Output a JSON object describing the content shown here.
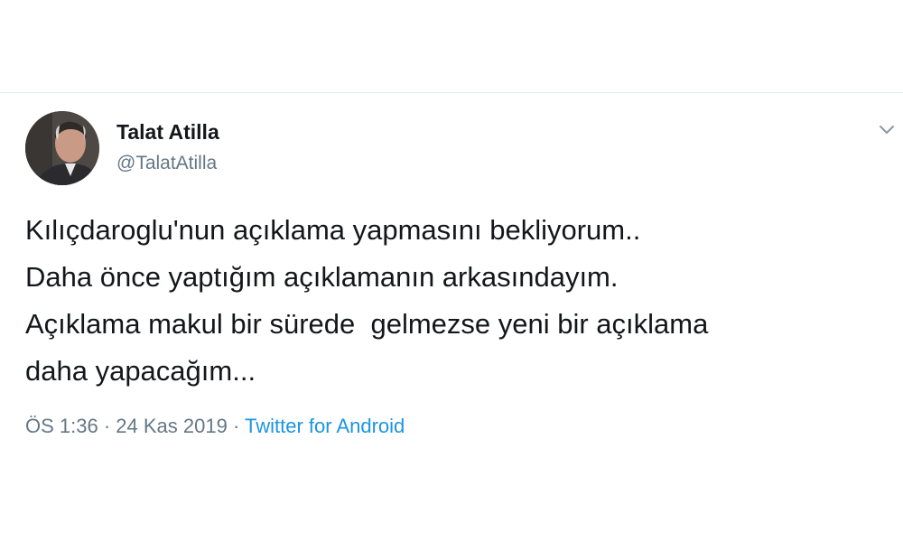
{
  "tweet": {
    "author": {
      "display_name": "Talat Atilla",
      "handle": "@TalatAtilla"
    },
    "text_lines": [
      "Kılıçdaroglu'nun açıklama yapmasını bekliyorum..",
      "Daha önce yaptığım açıklamanın arkasındayım.",
      "Açıklama makul bir sürede  gelmezse yeni bir açıklama",
      "daha yapacağım..."
    ],
    "time": "ÖS 1:36",
    "separator_1": " · ",
    "date": "24 Kas 2019",
    "separator_2": " · ",
    "source": "Twitter for Android",
    "more_icon": "chevron-down-icon"
  },
  "colors": {
    "text": "#14171a",
    "secondary": "#657786",
    "link": "#1b95e0",
    "divider": "#e6ecf0"
  }
}
